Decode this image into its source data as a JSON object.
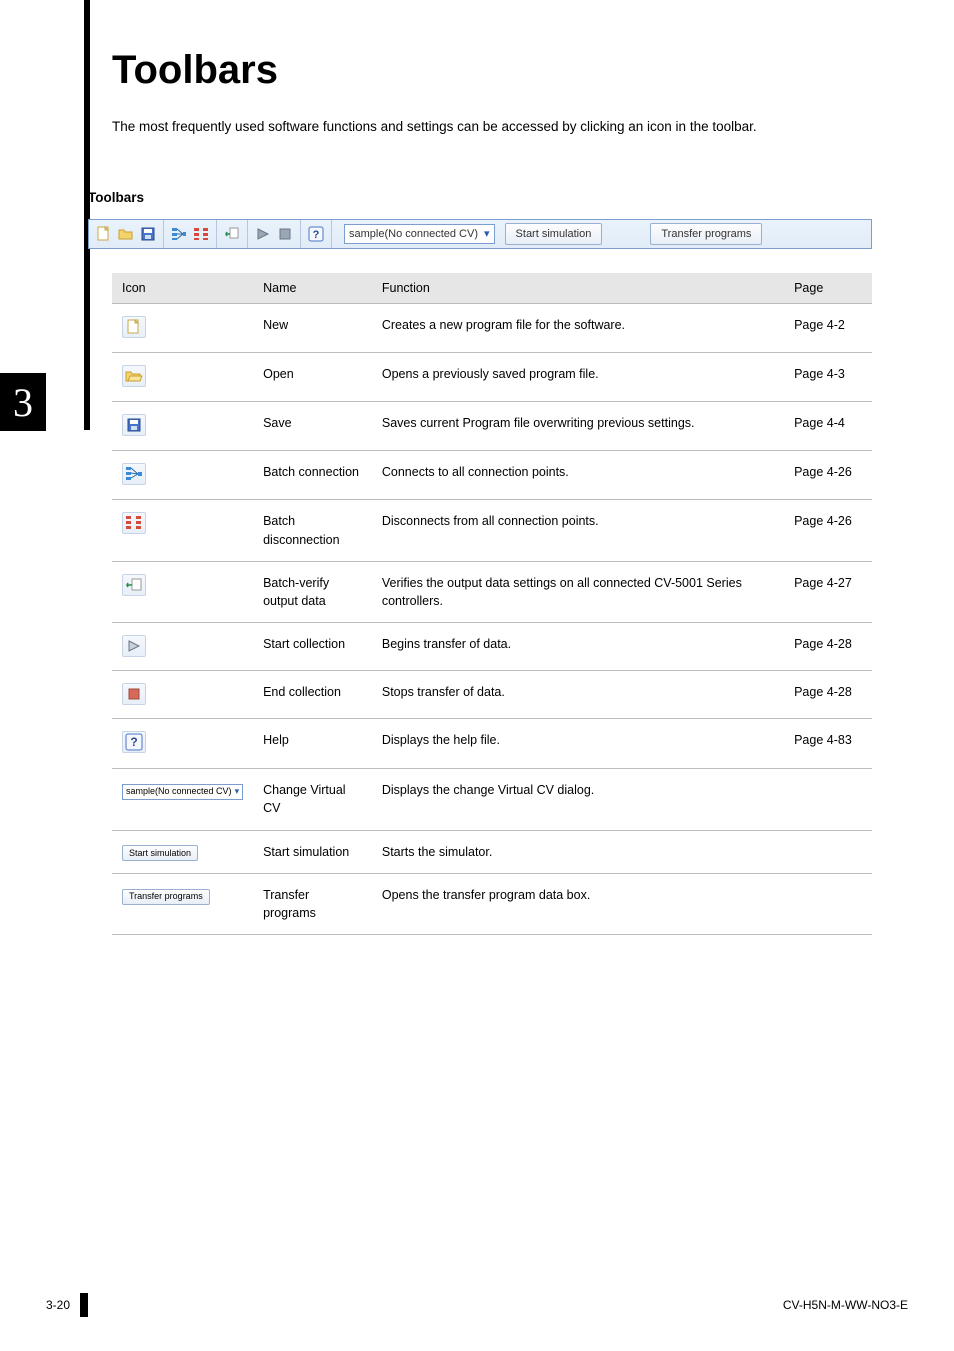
{
  "chapter_number": "3",
  "title": "Toolbars",
  "intro": "The most frequently used software functions and settings can be accessed by clicking an icon in the toolbar.",
  "subhead": "Toolbars",
  "toolbar": {
    "dropdown_label": "sample(No connected CV)",
    "start_sim_label": "Start simulation",
    "transfer_label": "Transfer programs"
  },
  "table": {
    "headers": {
      "icon": "Icon",
      "name": "Name",
      "func": "Function",
      "page": "Page"
    },
    "rows": [
      {
        "name": "New",
        "func": "Creates a new program file for the software.",
        "page": "Page 4-2",
        "icon_key": "new"
      },
      {
        "name": "Open",
        "func": "Opens a previously saved program file.",
        "page": "Page 4-3",
        "icon_key": "open"
      },
      {
        "name": "Save",
        "func": "Saves current Program file overwriting previous settings.",
        "page": "Page 4-4",
        "icon_key": "save"
      },
      {
        "name": "Batch connection",
        "func": "Connects to all connection points.",
        "page": "Page 4-26",
        "icon_key": "batch_conn"
      },
      {
        "name": "Batch disconnection",
        "func": "Disconnects from all connection points.",
        "page": "Page 4-26",
        "icon_key": "batch_disc"
      },
      {
        "name": "Batch-verify output data",
        "func": "Verifies the output data settings on all connected CV-5001 Series controllers.",
        "page": "Page 4-27",
        "icon_key": "batch_verify"
      },
      {
        "name": "Start collection",
        "func": "Begins transfer of data.",
        "page": "Page 4-28",
        "icon_key": "play"
      },
      {
        "name": "End collection",
        "func": "Stops transfer of data.",
        "page": "Page 4-28",
        "icon_key": "stop"
      },
      {
        "name": "Help",
        "func": "Displays the help file.",
        "page": "Page 4-83",
        "icon_key": "help"
      },
      {
        "name": "Change Virtual CV",
        "func": "Displays the change Virtual CV dialog.",
        "page": "",
        "icon_key": "dropdown"
      },
      {
        "name": "Start simulation",
        "func": "Starts the simulator.",
        "page": "",
        "icon_key": "btn_sim"
      },
      {
        "name": "Transfer programs",
        "func": "Opens the transfer program data box.",
        "page": "",
        "icon_key": "btn_transfer"
      }
    ]
  },
  "footer": {
    "page_num": "3-20",
    "doc_id": "CV-H5N-M-WW-NO3-E"
  }
}
